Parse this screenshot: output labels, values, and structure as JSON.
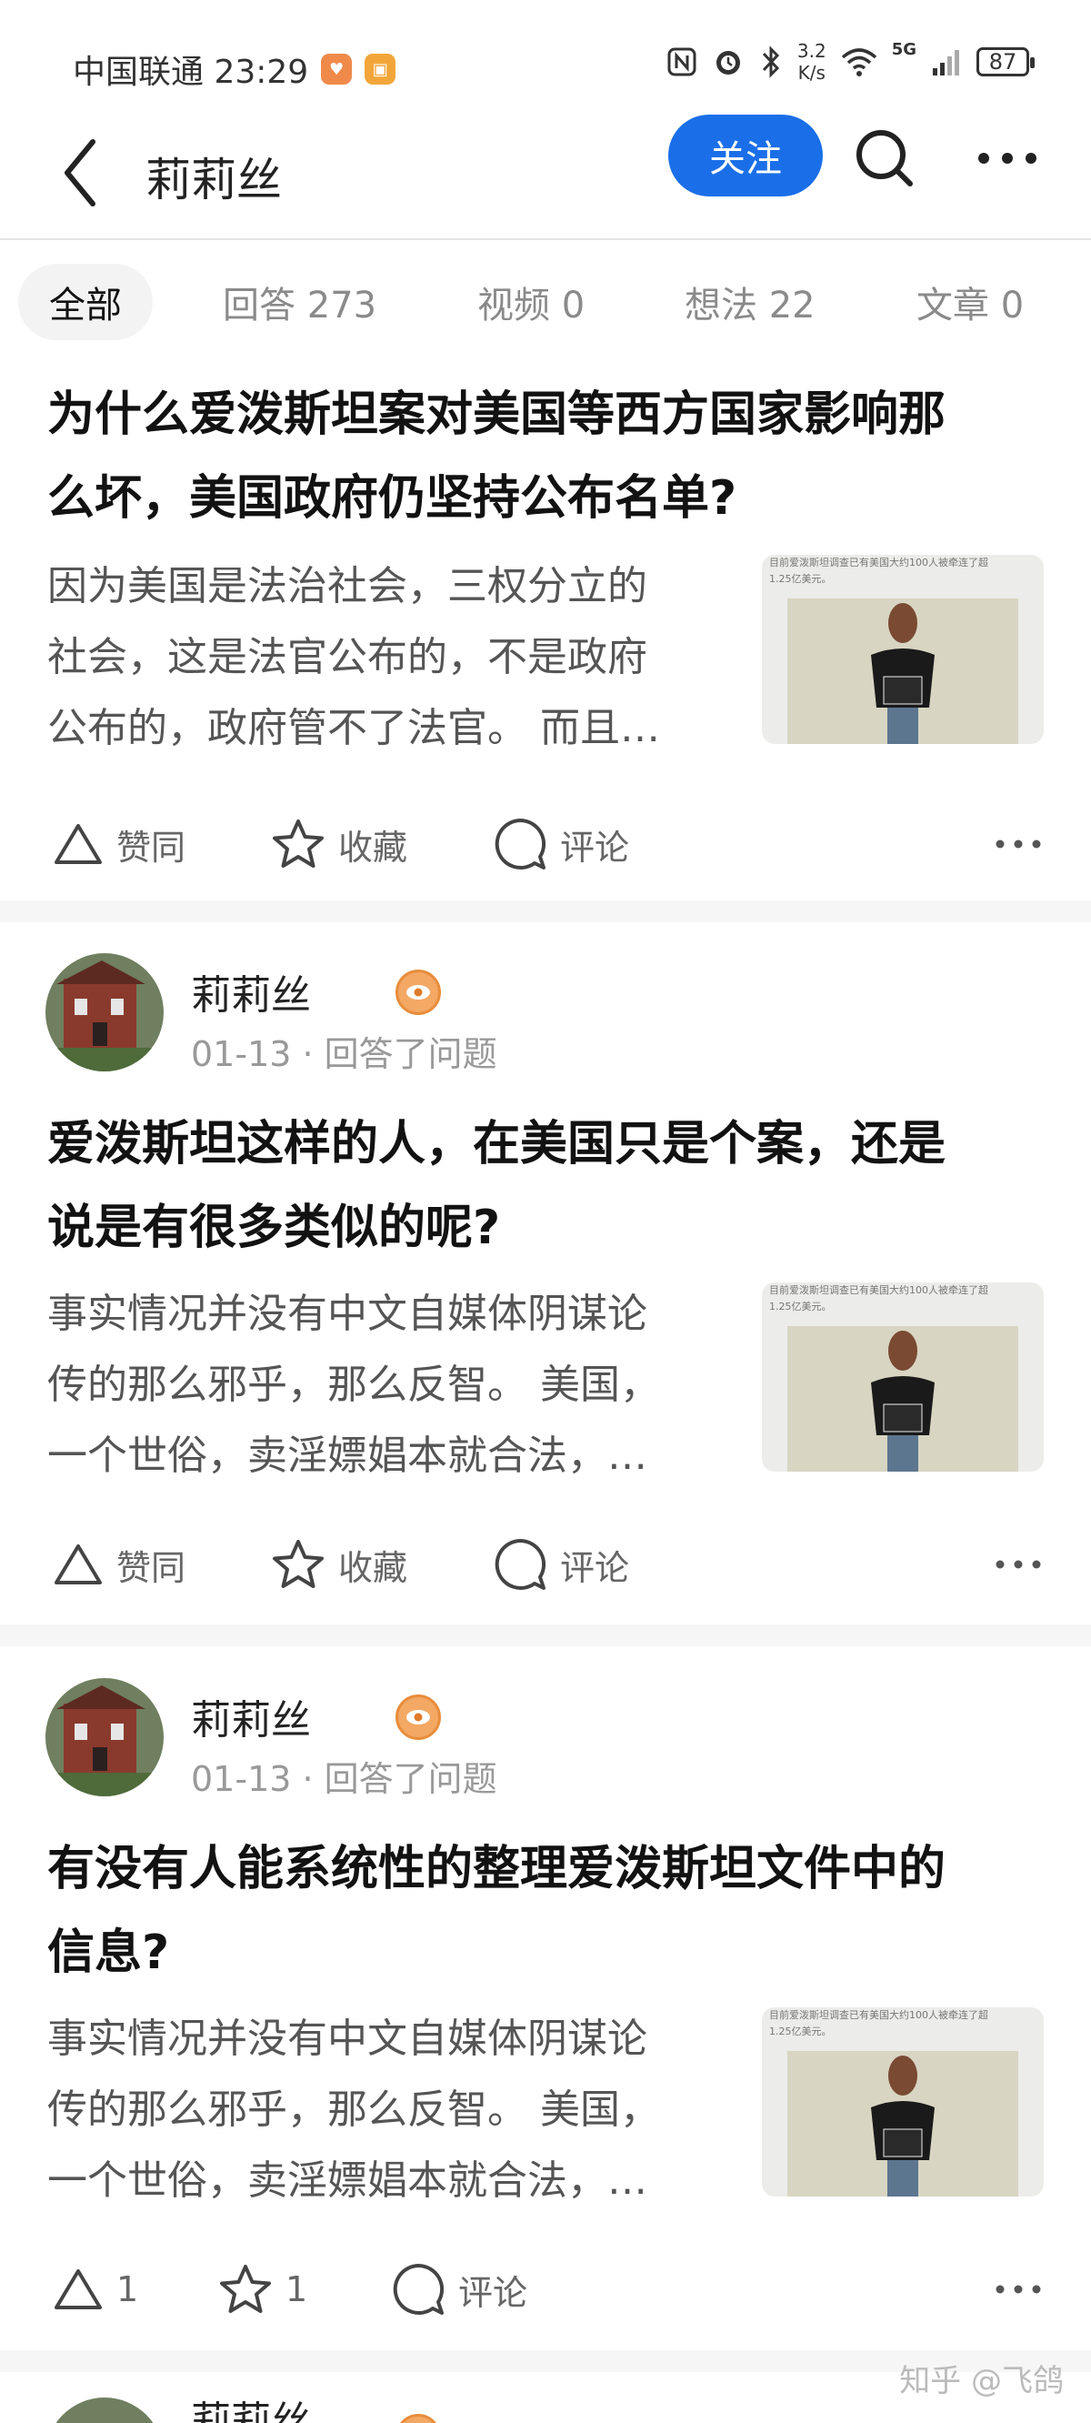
{
  "status_bar": {
    "carrier_time": "中国联通 23:29",
    "net_speed": "3.2",
    "net_unit": "K/s",
    "signal": "5G",
    "battery": "87"
  },
  "header": {
    "title": "莉莉丝",
    "follow_label": "关注"
  },
  "tabs": [
    {
      "label": "全部"
    },
    {
      "label": "回答 273"
    },
    {
      "label": "视频 0"
    },
    {
      "label": "想法 22"
    },
    {
      "label": "文章 0"
    }
  ],
  "cards": [
    {
      "title_lines": [
        "为什么爱泼斯坦案对美国等西方国家影响那",
        "么坏，美国政府仍坚持公布名单?"
      ],
      "excerpt_lines": [
        "因为美国是法治社会，三权分立的",
        "社会，这是法官公布的，不是政府",
        "公布的，政府管不了法官。 而且…"
      ],
      "thumb_caption": [
        "目前爱泼斯坦调查已有美国大约100人被牵连了超",
        "1.25亿美元。"
      ],
      "actions": {
        "upvote": "赞同",
        "favorite": "收藏",
        "comment": "评论"
      }
    },
    {
      "author": "莉莉丝",
      "meta": "01-13 · 回答了问题",
      "title_lines": [
        "爱泼斯坦这样的人，在美国只是个案，还是",
        "说是有很多类似的呢?"
      ],
      "excerpt_lines": [
        "事实情况并没有中文自媒体阴谋论",
        "传的那么邪乎，那么反智。 美国，",
        "一个世俗，卖淫嫖娼本就合法，…"
      ],
      "thumb_caption": [
        "目前爱泼斯坦调查已有美国大约100人被牵连了超",
        "1.25亿美元。"
      ],
      "actions": {
        "upvote": "赞同",
        "favorite": "收藏",
        "comment": "评论"
      }
    },
    {
      "author": "莉莉丝",
      "meta": "01-13 · 回答了问题",
      "title_lines": [
        "有没有人能系统性的整理爱泼斯坦文件中的",
        "信息?"
      ],
      "excerpt_lines": [
        "事实情况并没有中文自媒体阴谋论",
        "传的那么邪乎，那么反智。 美国，",
        "一个世俗，卖淫嫖娼本就合法，…"
      ],
      "thumb_caption": [
        "目前爱泼斯坦调查已有美国大约100人被牵连了超",
        "1.25亿美元。"
      ],
      "actions": {
        "upvote": "1",
        "favorite": "1",
        "comment": "评论"
      }
    }
  ],
  "next_author": "莉莉丝",
  "watermark": "知乎 @飞鸽"
}
